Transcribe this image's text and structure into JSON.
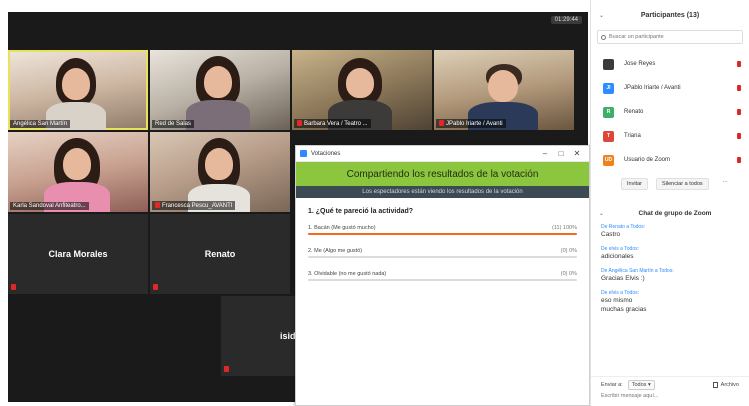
{
  "meeting": {
    "elapsed_time": "01:29:44"
  },
  "tiles": [
    {
      "name": "Angélica San Martín",
      "muted": false,
      "active": true
    },
    {
      "name": "Red de Salas",
      "muted": false
    },
    {
      "name": "Barbara Vera / Teatro ...",
      "muted": true
    },
    {
      "name": "JPablo Iriarte / Avanti",
      "muted": true
    },
    {
      "name": "Karla Sandoval Anfiteatro...",
      "muted": false
    },
    {
      "name": "Francesca Pescu_AVANTI",
      "muted": true
    },
    {
      "name": "Clara Morales",
      "muted": true
    },
    {
      "name": "Renato",
      "muted": true
    },
    {
      "name": "isido",
      "muted": true
    }
  ],
  "poll": {
    "window_title": "Votaciones",
    "banner": "Compartiendo los resultados de la votación",
    "subtitle": "Los espectadores están viendo los resultados de la votación",
    "question": "1. ¿Qué te pareció la actividad?",
    "options": [
      {
        "label": "1. Bacán (Me gustó mucho)",
        "count": "(11) 100%",
        "percent": 100
      },
      {
        "label": "2. Me (Algo me gustó)",
        "count": "(0) 0%",
        "percent": 0
      },
      {
        "label": "3. Olvidable (no me gustó nada)",
        "count": "(0) 0%",
        "percent": 0
      }
    ],
    "colors": {
      "banner": "#8cc63f",
      "bar_fill": "#f26c22"
    }
  },
  "participants": {
    "title": "Participantes (13)",
    "search_placeholder": "Buscar un participante",
    "list": [
      {
        "initials": "",
        "name": "Jose Reyes",
        "color": "#3b3b3b"
      },
      {
        "initials": "JI",
        "name": "JPablo Iriarte / Avanti",
        "color": "#2d8cff"
      },
      {
        "initials": "R",
        "name": "Renato",
        "color": "#3fae6b"
      },
      {
        "initials": "T",
        "name": "Triana",
        "color": "#e0453a"
      },
      {
        "initials": "UD",
        "name": "Usuario de Zoom",
        "color": "#f0821e"
      }
    ],
    "invite_label": "Invitar",
    "mute_all_label": "Silenciar a todos",
    "more_label": "..."
  },
  "chat": {
    "title": "Chat de grupo de Zoom",
    "messages": [
      {
        "from": "De Renato a Todos:",
        "lines": [
          "Castro"
        ]
      },
      {
        "from": "De elvis a Todos:",
        "lines": [
          "adicionales"
        ]
      },
      {
        "from": "De Angélica San Martín a Todos:",
        "lines": [
          "Gracias Elvis :)"
        ]
      },
      {
        "from": "De elvis a Todos:",
        "lines": [
          "eso mismo",
          "muchas gracias"
        ]
      }
    ],
    "send_to_label": "Enviar a:",
    "send_to_value": "Todos",
    "file_label": "Archivo",
    "input_placeholder": "Escribir mensaje aquí..."
  }
}
